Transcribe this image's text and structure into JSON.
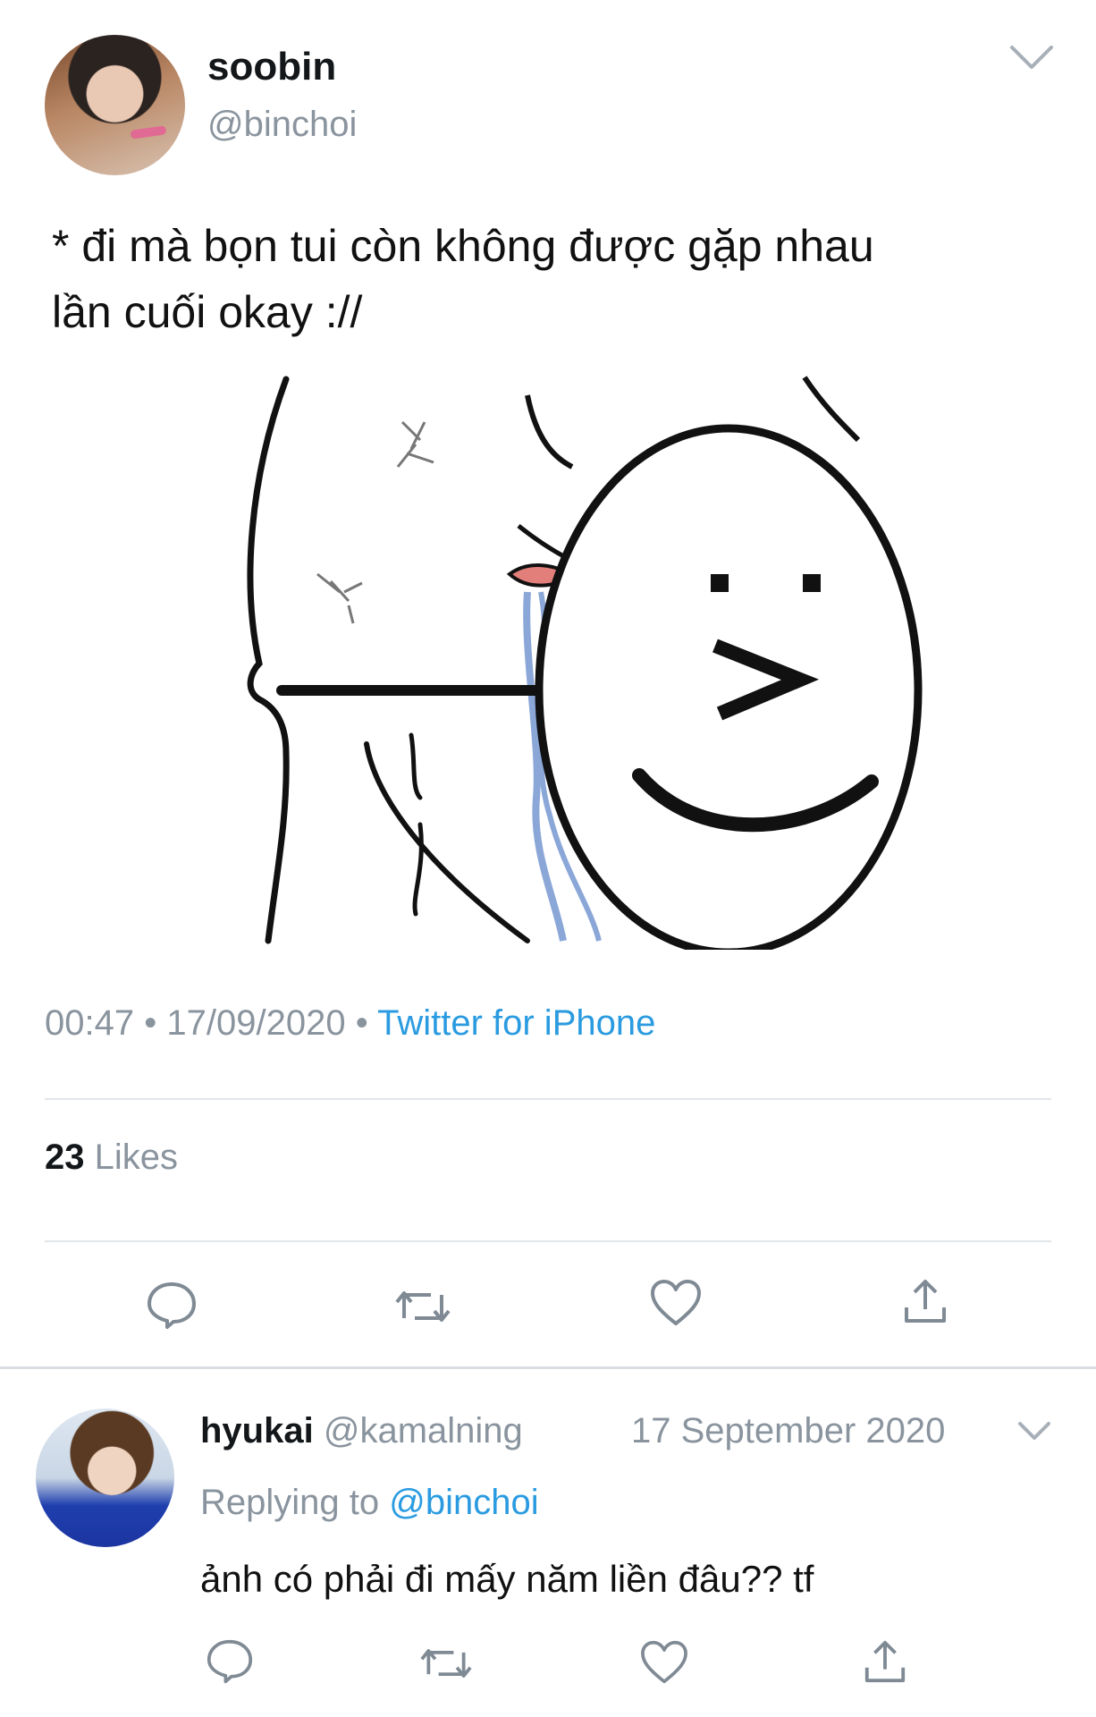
{
  "tweet": {
    "display_name": "soobin",
    "handle": "@binchoi",
    "text_line1": "* đi mà bọn tui còn không được gặp nhau",
    "text_line2": "lần cuối okay ://",
    "time": "00:47",
    "separator": "•",
    "date": "17/09/2020",
    "source": "Twitter for iPhone",
    "likes_count": "23",
    "likes_label": "Likes"
  },
  "reply": {
    "display_name": "hyukai",
    "handle": "@kamalning",
    "date": "17 September 2020",
    "replying_prefix": "Replying to",
    "replying_to": "@binchoi",
    "text": "ảnh có phải đi mấy năm liền đâu?? tf"
  },
  "icons": {
    "reply": "speech-bubble-icon",
    "retweet": "retweet-icon",
    "like": "heart-icon",
    "share": "share-icon",
    "more": "chevron-down-icon"
  },
  "colors": {
    "link": "#2a9be0",
    "muted": "#8a949e",
    "divider": "#e2e6ea"
  }
}
